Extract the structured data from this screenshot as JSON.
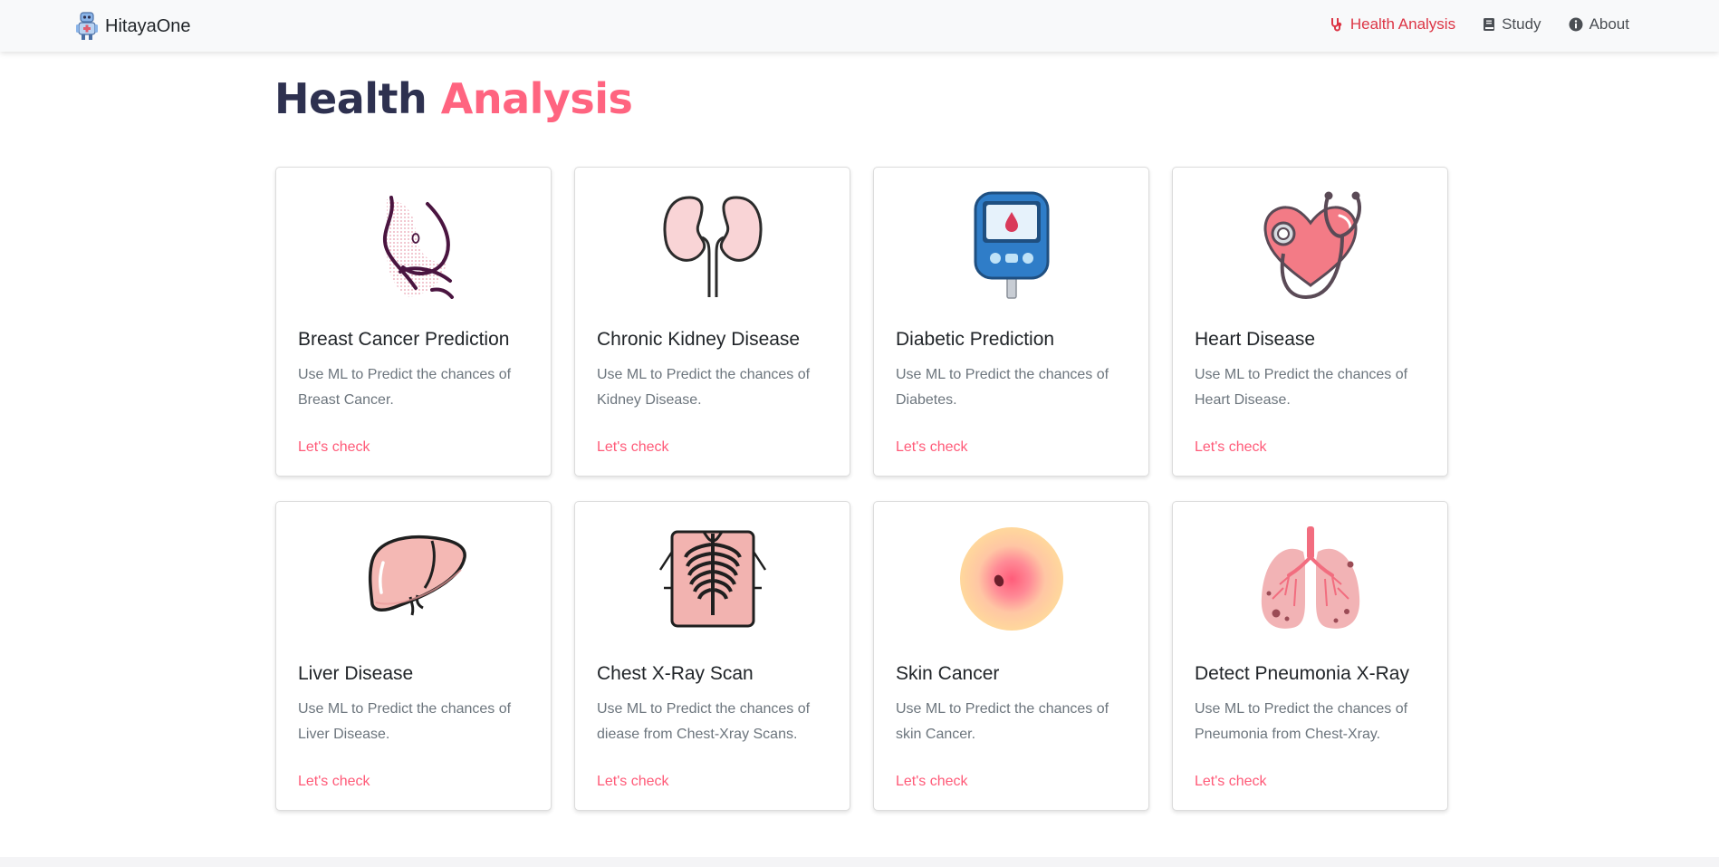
{
  "app": {
    "brand": "HitayaOne",
    "logo_icon": "robot-doctor-icon"
  },
  "nav": {
    "items": [
      {
        "label": "Health Analysis",
        "icon": "stethoscope-icon",
        "active": true
      },
      {
        "label": "Study",
        "icon": "book-icon",
        "active": false
      },
      {
        "label": "About",
        "icon": "info-circle-icon",
        "active": false
      }
    ]
  },
  "page": {
    "title_part1": "Health",
    "title_part2": "Analysis"
  },
  "colors": {
    "accent": "#ff6480",
    "title_dark": "#2e3150",
    "link": "#ff5a78",
    "nav_active": "#dc3545"
  },
  "cards": [
    {
      "title": "Breast Cancer Prediction",
      "text": "Use ML to Predict the chances of Breast Cancer.",
      "link": "Let's check",
      "icon": "breast-icon"
    },
    {
      "title": "Chronic Kidney Disease",
      "text": "Use ML to Predict the chances of Kidney Disease.",
      "link": "Let's check",
      "icon": "kidney-icon"
    },
    {
      "title": "Diabetic Prediction",
      "text": "Use ML to Predict the chances of Diabetes.",
      "link": "Let's check",
      "icon": "glucose-meter-icon"
    },
    {
      "title": "Heart Disease",
      "text": "Use ML to Predict the chances of Heart Disease.",
      "link": "Let's check",
      "icon": "heart-stethoscope-icon"
    },
    {
      "title": "Liver Disease",
      "text": "Use ML to Predict the chances of Liver Disease.",
      "link": "Let's check",
      "icon": "liver-icon"
    },
    {
      "title": "Chest X-Ray Scan",
      "text": "Use ML to Predict the chances of diease from Chest-Xray Scans.",
      "link": "Let's check",
      "icon": "chest-xray-icon"
    },
    {
      "title": "Skin Cancer",
      "text": "Use ML to Predict the chances of skin Cancer.",
      "link": "Let's check",
      "icon": "skin-lesion-icon"
    },
    {
      "title": "Detect Pneumonia X-Ray",
      "text": "Use ML to Predict the chances of Pneumonia from Chest-Xray.",
      "link": "Let's check",
      "icon": "lungs-icon"
    }
  ]
}
